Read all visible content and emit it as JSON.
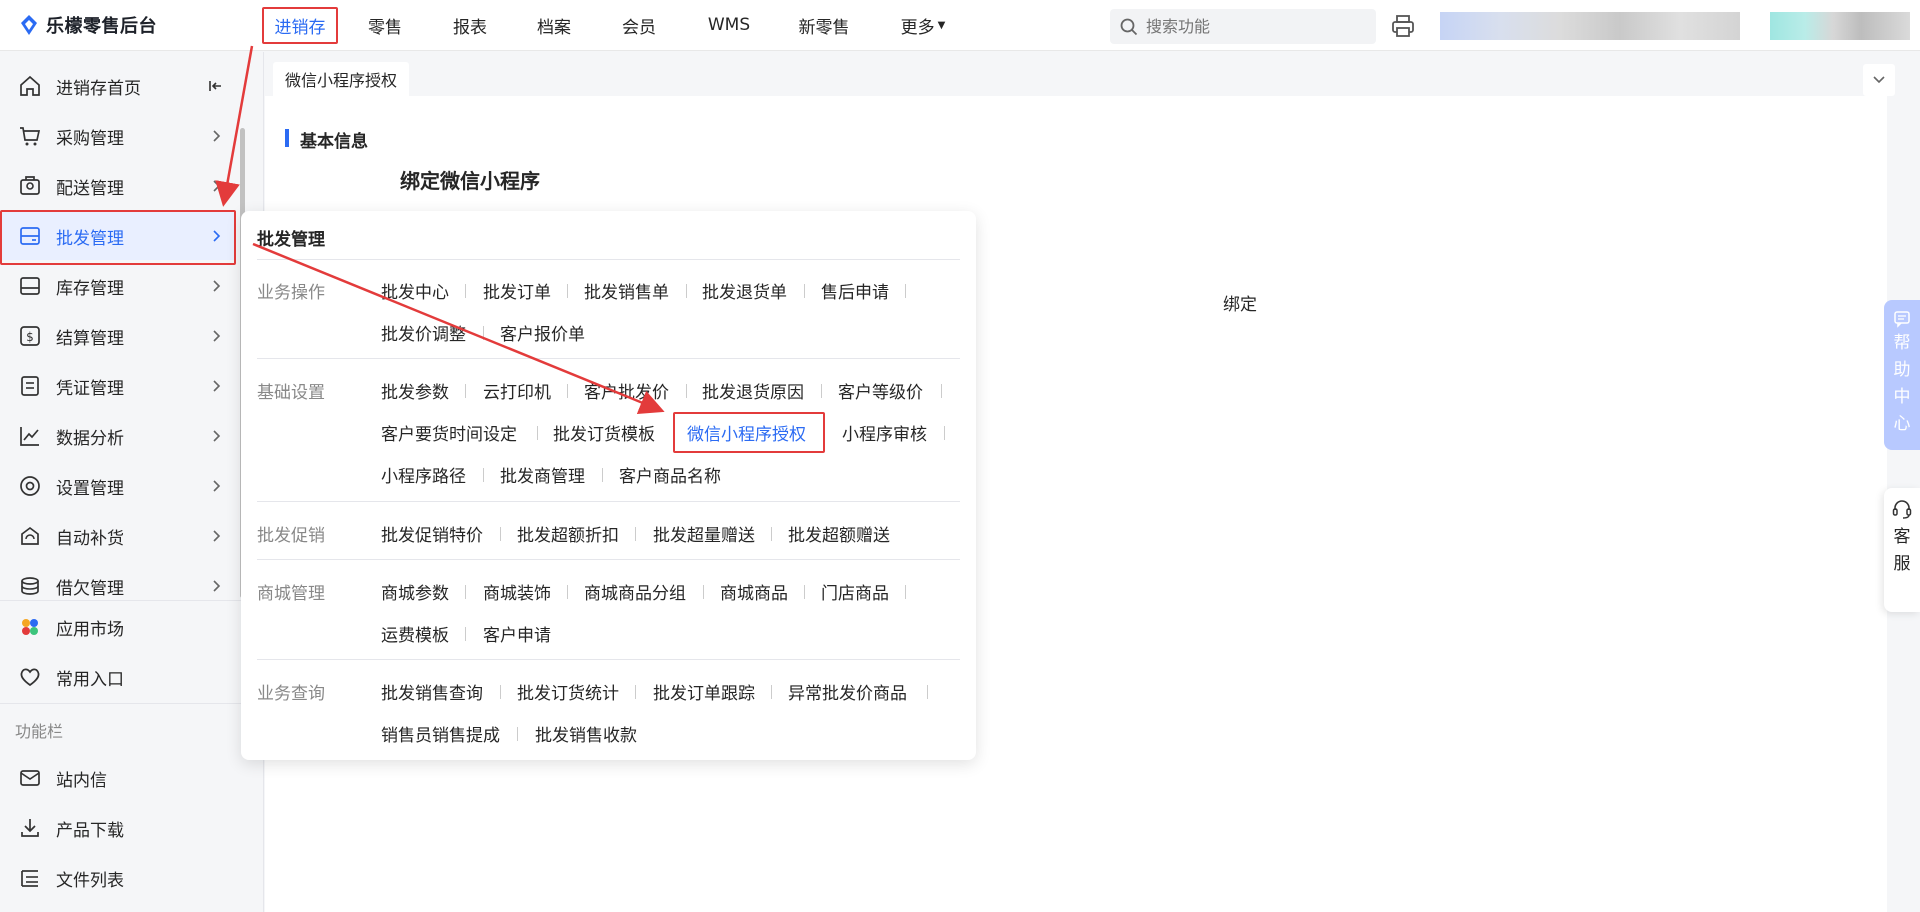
{
  "brand": {
    "title": "乐檬零售后台"
  },
  "nav": {
    "items": [
      {
        "label": "进销存",
        "active": true
      },
      {
        "label": "零售"
      },
      {
        "label": "报表"
      },
      {
        "label": "档案"
      },
      {
        "label": "会员"
      },
      {
        "label": "WMS"
      },
      {
        "label": "新零售"
      },
      {
        "label": "更多"
      }
    ]
  },
  "search": {
    "placeholder": "搜索功能"
  },
  "sidebar": {
    "items": [
      {
        "label": "进销存首页",
        "icon": "home-icon"
      },
      {
        "label": "采购管理",
        "icon": "cart-icon"
      },
      {
        "label": "配送管理",
        "icon": "delivery-icon"
      },
      {
        "label": "批发管理",
        "icon": "wholesale-icon",
        "active": true
      },
      {
        "label": "库存管理",
        "icon": "inventory-icon"
      },
      {
        "label": "结算管理",
        "icon": "settlement-icon"
      },
      {
        "label": "凭证管理",
        "icon": "voucher-icon"
      },
      {
        "label": "数据分析",
        "icon": "chart-icon"
      },
      {
        "label": "设置管理",
        "icon": "settings-icon"
      },
      {
        "label": "自动补货",
        "icon": "restock-icon"
      },
      {
        "label": "借欠管理",
        "icon": "debt-icon"
      }
    ],
    "extra": [
      {
        "label": "应用市场",
        "icon": "app-market-icon"
      },
      {
        "label": "常用入口",
        "icon": "heart-icon"
      }
    ],
    "section_label": "功能栏",
    "tools": [
      {
        "label": "站内信",
        "icon": "mail-icon"
      },
      {
        "label": "产品下载",
        "icon": "download-icon"
      },
      {
        "label": "文件列表",
        "icon": "file-list-icon"
      }
    ]
  },
  "tabs": [
    {
      "label": "微信小程序授权"
    }
  ],
  "content": {
    "section_title": "基本信息",
    "bind_title": "绑定微信小程序",
    "bind_tail": "绑定"
  },
  "popup": {
    "title": "批发管理",
    "groups": [
      {
        "label": "业务操作",
        "links": [
          "批发中心",
          "批发订单",
          "批发销售单",
          "批发退货单",
          "售后申请",
          "批发价调整",
          "客户报价单"
        ]
      },
      {
        "label": "基础设置",
        "links": [
          "批发参数",
          "云打印机",
          "客户批发价",
          "批发退货原因",
          "客户等级价",
          "客户要货时间设定",
          "批发订货模板",
          "微信小程序授权",
          "小程序审核",
          "小程序路径",
          "批发商管理",
          "客户商品名称"
        ]
      },
      {
        "label": "批发促销",
        "links": [
          "批发促销特价",
          "批发超额折扣",
          "批发超量赠送",
          "批发超额赠送"
        ]
      },
      {
        "label": "商城管理",
        "links": [
          "商城参数",
          "商城装饰",
          "商城商品分组",
          "商城商品",
          "门店商品",
          "运费模板",
          "客户申请"
        ]
      },
      {
        "label": "业务查询",
        "links": [
          "批发销售查询",
          "批发订货统计",
          "批发订单跟踪",
          "异常批发价商品",
          "销售员销售提成",
          "批发销售收款"
        ]
      }
    ]
  },
  "float": {
    "help": [
      "帮",
      "助",
      "中",
      "心"
    ],
    "service": [
      "客",
      "服"
    ]
  },
  "colors": {
    "accent": "#2b6bf3",
    "annotation": "#e33b3b"
  }
}
